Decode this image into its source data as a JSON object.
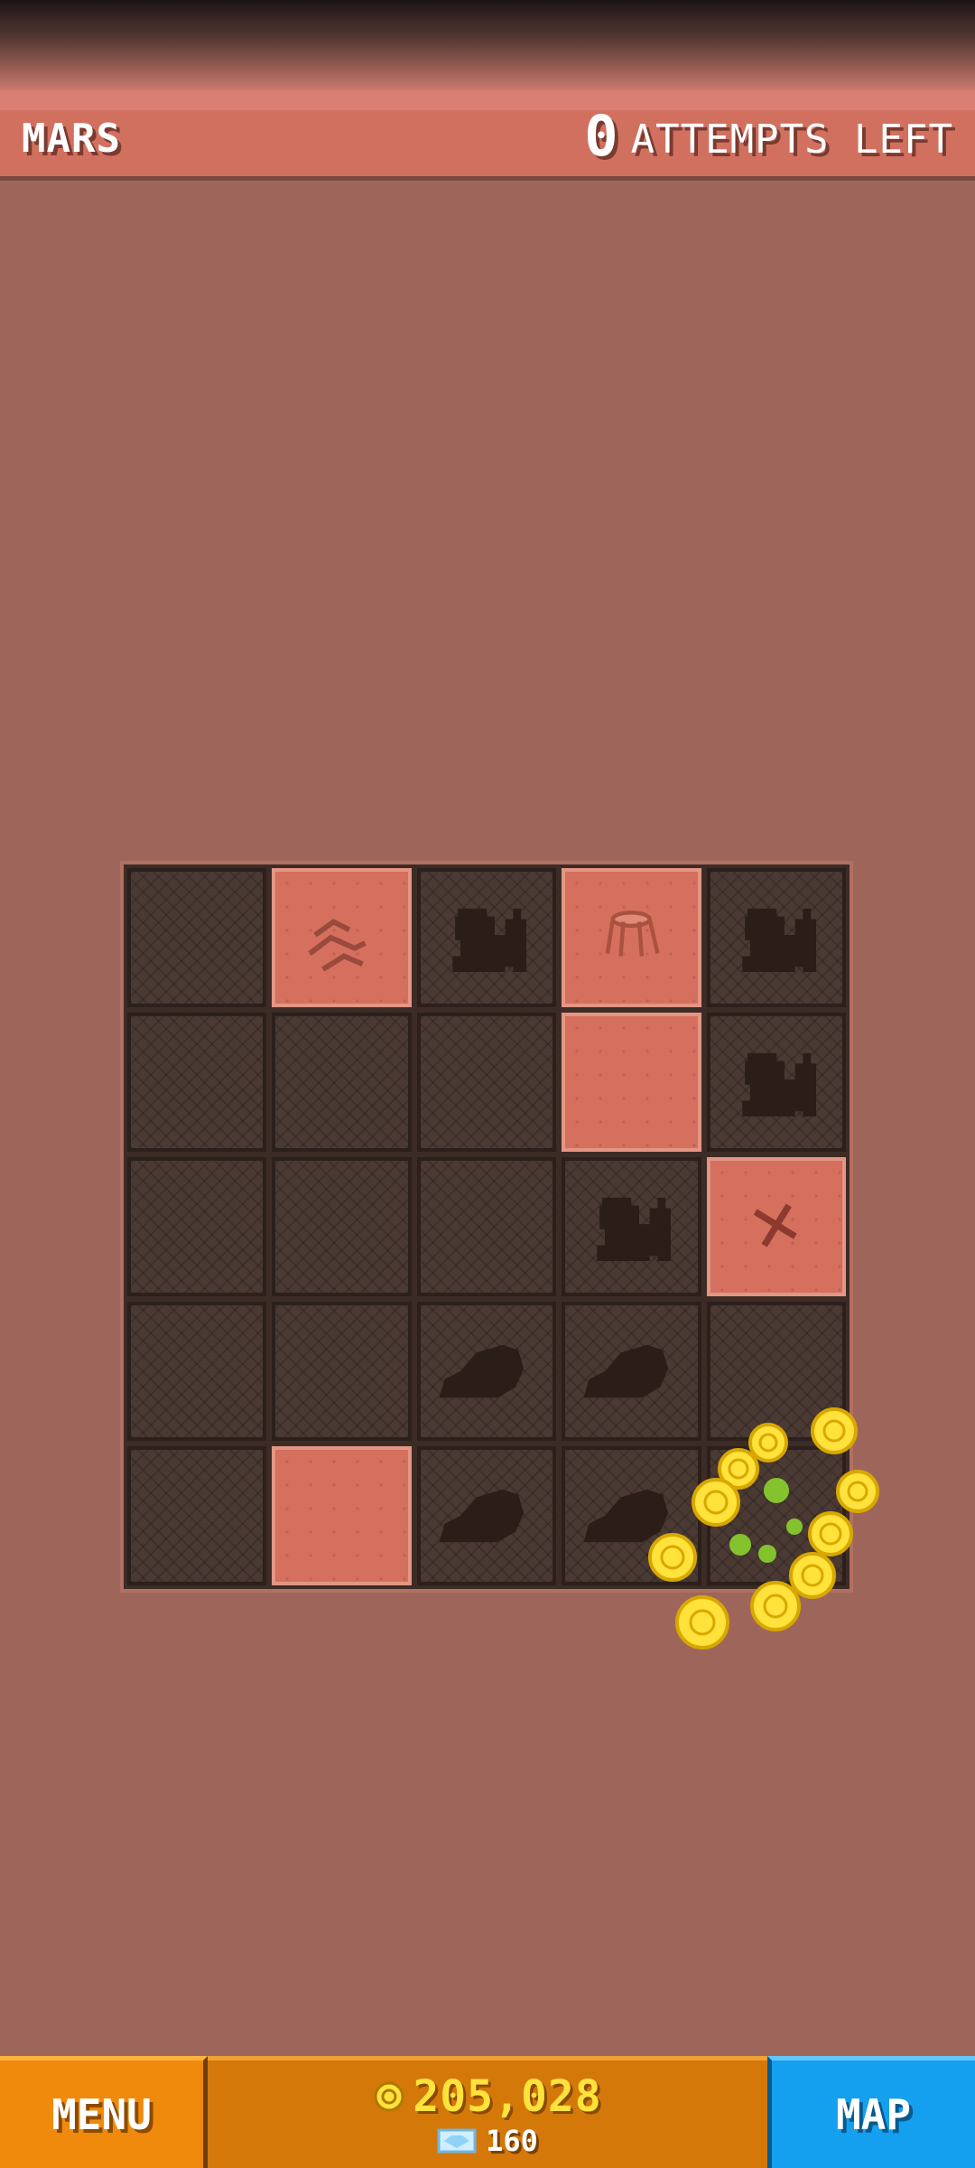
{
  "header": {
    "planet": "MARS",
    "attempts_count": "0",
    "attempts_label": "ATTEMPTS LEFT"
  },
  "board": {
    "cells": [
      [
        "hidden",
        "dug-claw-marks",
        "hidden-creature-silhouette",
        "dug-stump",
        "hidden-creature-silhouette"
      ],
      [
        "hidden",
        "hidden",
        "hidden",
        "dug",
        "hidden-creature-silhouette"
      ],
      [
        "hidden",
        "hidden",
        "hidden",
        "hidden-creature-silhouette",
        "dug-x-mark"
      ],
      [
        "hidden",
        "hidden",
        "hidden-rock-silhouette",
        "hidden-rock-silhouette",
        "hidden"
      ],
      [
        "hidden",
        "dug",
        "hidden-rock-silhouette",
        "hidden-rock-silhouette",
        "hidden"
      ]
    ]
  },
  "footer": {
    "menu_label": "MENU",
    "coins": "205,028",
    "gems": "160",
    "map_label": "MAP"
  },
  "colors": {
    "background": "#9e665a",
    "header": "#d2705f",
    "dug_tile": "#d56f5e",
    "hidden_tile": "#4a3a33",
    "menu_button": "#f08a0c",
    "map_button": "#14a0ee",
    "coin": "#ffe23c"
  }
}
